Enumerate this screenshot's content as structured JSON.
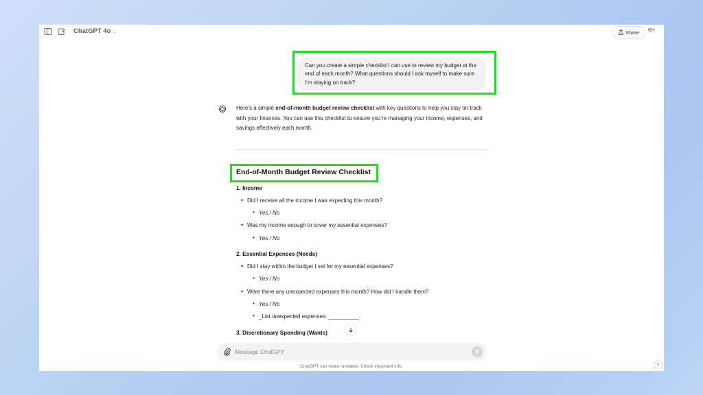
{
  "app": {
    "model_name": "ChatGPT 4o",
    "share_label": "Share",
    "avatar_initials": "KH"
  },
  "conversation": {
    "user_message": "Can you create a simple checklist I can use to review my budget at the end of each month? What questions should I ask myself to make sure I’m staying on track?",
    "intro": {
      "before": "Here’s a simple ",
      "bold": "end-of-month budget review checklist",
      "after": " with key questions to help you stay on track with your finances. You can use this checklist to ensure you’re managing your income, expenses, and savings effectively each month."
    },
    "checklist_title": "End-of-Month Budget Review Checklist",
    "sections": [
      {
        "title": "1. Income",
        "items": [
          {
            "q": "Did I receive all the income I was expecting this month?",
            "answers": [
              "Yes / No"
            ]
          },
          {
            "q": "Was my income enough to cover my essential expenses?",
            "answers": [
              "Yes / No"
            ]
          }
        ]
      },
      {
        "title": "2. Essential Expenses (Needs)",
        "items": [
          {
            "q": "Did I stay within the budget I set for my essential expenses?",
            "answers": [
              "Yes / No"
            ]
          },
          {
            "q": "Were there any unexpected expenses this month? How did I handle them?",
            "answers": [
              "Yes / No",
              "_List unexpected expenses: __________."
            ]
          }
        ]
      },
      {
        "title": "3. Discretionary Spending (Wants)",
        "items": []
      }
    ]
  },
  "composer": {
    "placeholder": "Message ChatGPT"
  },
  "footer": {
    "disclaimer": "ChatGPT can make mistakes. Check important info.",
    "help_label": "?"
  },
  "colors": {
    "highlight": "#1be01b",
    "bubble": "#f2f2f2"
  }
}
